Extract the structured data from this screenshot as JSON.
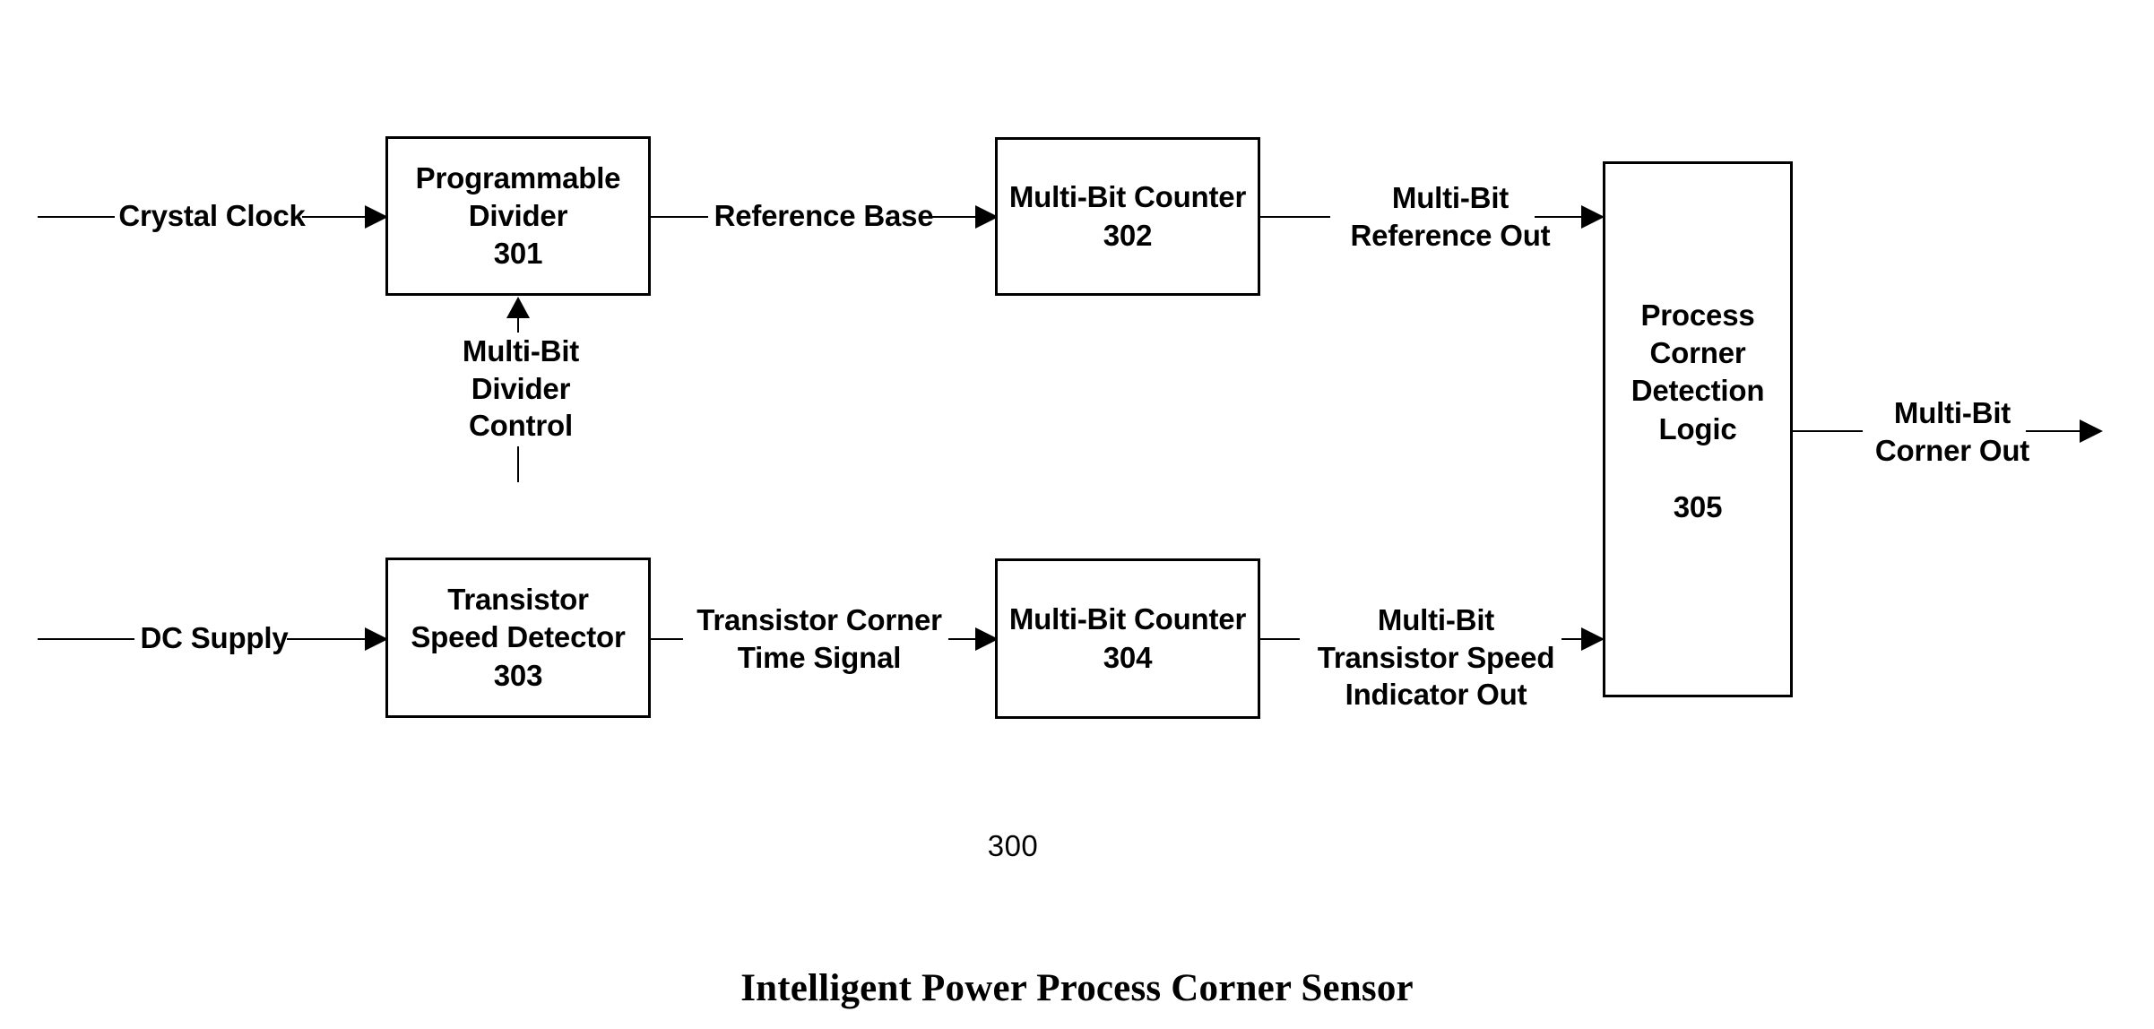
{
  "figure": {
    "number": "300",
    "caption": "Intelligent Power Process Corner Sensor"
  },
  "blocks": {
    "divider": {
      "line1": "Programmable",
      "line2": "Divider",
      "ref": "301"
    },
    "counter_ref": {
      "line1": "Multi-Bit Counter",
      "ref": "302"
    },
    "speed_detector": {
      "line1": "Transistor",
      "line2": "Speed Detector",
      "ref": "303"
    },
    "counter_speed": {
      "line1": "Multi-Bit Counter",
      "ref": "304"
    },
    "detection_logic": {
      "line1": "Process",
      "line2": "Corner",
      "line3": "Detection",
      "line4": "Logic",
      "ref": "305"
    }
  },
  "signals": {
    "crystal_clock": {
      "line1": "Crystal Clock"
    },
    "reference_base": {
      "line1": "Reference Base"
    },
    "multibit_reference_out": {
      "line1": "Multi-Bit",
      "line2": "Reference Out"
    },
    "multibit_divider_control": {
      "line1": "Multi-Bit",
      "line2": "Divider",
      "line3": "Control"
    },
    "dc_supply": {
      "line1": "DC Supply"
    },
    "transistor_corner_time_signal": {
      "line1": "Transistor Corner",
      "line2": "Time Signal"
    },
    "multibit_transistor_speed_indicator_out": {
      "line1": "Multi-Bit",
      "line2": "Transistor Speed",
      "line3": "Indicator Out"
    },
    "multibit_corner_out": {
      "line1": "Multi-Bit",
      "line2": "Corner Out"
    }
  },
  "colors": {
    "stroke": "#000000",
    "background": "#ffffff"
  }
}
